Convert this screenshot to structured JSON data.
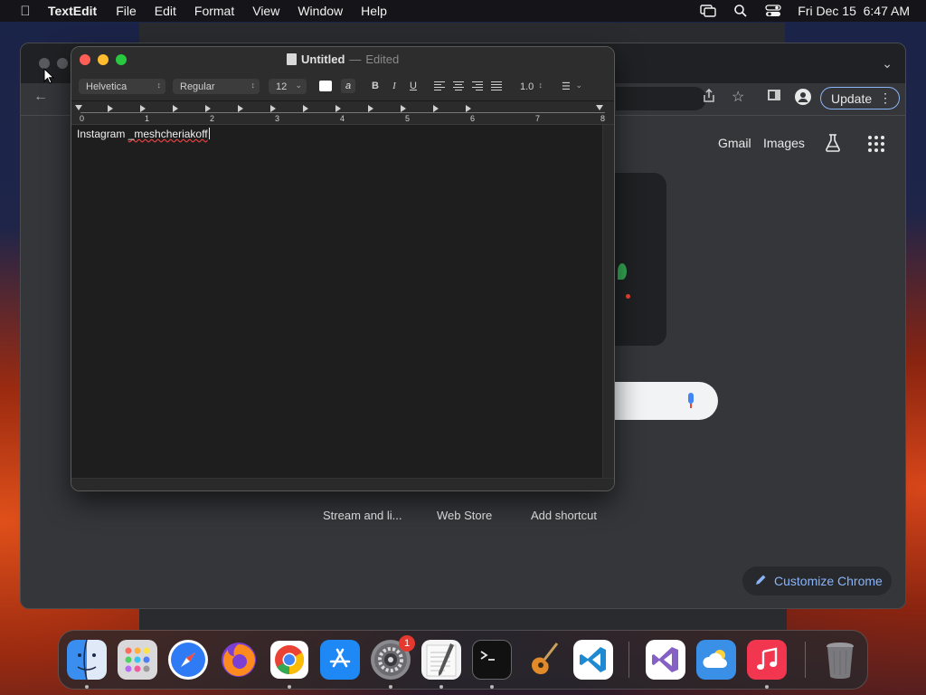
{
  "menubar": {
    "app_name": "TextEdit",
    "items": [
      "File",
      "Edit",
      "Format",
      "View",
      "Window",
      "Help"
    ],
    "datetime": "Fri Dec 15  6:47 AM",
    "icons": [
      "apple-icon",
      "screen-mirroring-icon",
      "spotlight-search-icon",
      "control-center-icon"
    ]
  },
  "chrome": {
    "update_label": "Update",
    "nav_links": [
      "Gmail",
      "Images"
    ],
    "shortcuts": [
      "Stream and li...",
      "Web Store",
      "Add shortcut"
    ],
    "customize_label": "Customize Chrome"
  },
  "textedit": {
    "title": "Untitled",
    "separator": "—",
    "status": "Edited",
    "font_family": "Helvetica",
    "font_style": "Regular",
    "font_size": "12",
    "highlight_label": "a",
    "bold_label": "B",
    "italic_label": "I",
    "underline_label": "U",
    "line_spacing": "1.0",
    "list_label": "☰",
    "ruler_numbers": [
      "0",
      "1",
      "2",
      "3",
      "4",
      "5",
      "6",
      "7",
      "8"
    ],
    "text_prefix": "Instagram ",
    "text_word": "_meshcheriakoff"
  },
  "dock": {
    "apps": [
      {
        "name": "Finder",
        "icon": "finder-icon",
        "color": "#3a8ef0"
      },
      {
        "name": "Launchpad",
        "icon": "launchpad-icon",
        "color": "#d9d9dc"
      },
      {
        "name": "Safari",
        "icon": "safari-icon",
        "color": "#2f7bf5"
      },
      {
        "name": "Firefox",
        "icon": "firefox-icon",
        "color": "#7b3fd4"
      },
      {
        "name": "Google Chrome",
        "icon": "chrome-icon",
        "color": "#ffffff"
      },
      {
        "name": "App Store",
        "icon": "app-store-icon",
        "color": "#1e88f5"
      },
      {
        "name": "System Settings",
        "icon": "system-settings-icon",
        "color": "#8a8a8e"
      },
      {
        "name": "TextEdit",
        "icon": "textedit-icon",
        "color": "#f4f4f4"
      },
      {
        "name": "Terminal",
        "icon": "terminal-icon",
        "color": "#111111"
      },
      {
        "name": "GarageBand",
        "icon": "garageband-icon",
        "color": "#e08a2a"
      },
      {
        "name": "Visual Studio Code",
        "icon": "vscode-icon",
        "color": "#ffffff"
      },
      {
        "name": "Visual Studio",
        "icon": "visual-studio-icon",
        "color": "#ffffff"
      },
      {
        "name": "Weather",
        "icon": "weather-icon",
        "color": "#3a8fe6"
      },
      {
        "name": "Music",
        "icon": "music-icon",
        "color": "#f2364f"
      },
      {
        "name": "Trash",
        "icon": "trash-icon",
        "color": "#8c8c90"
      }
    ],
    "settings_badge": "1"
  }
}
